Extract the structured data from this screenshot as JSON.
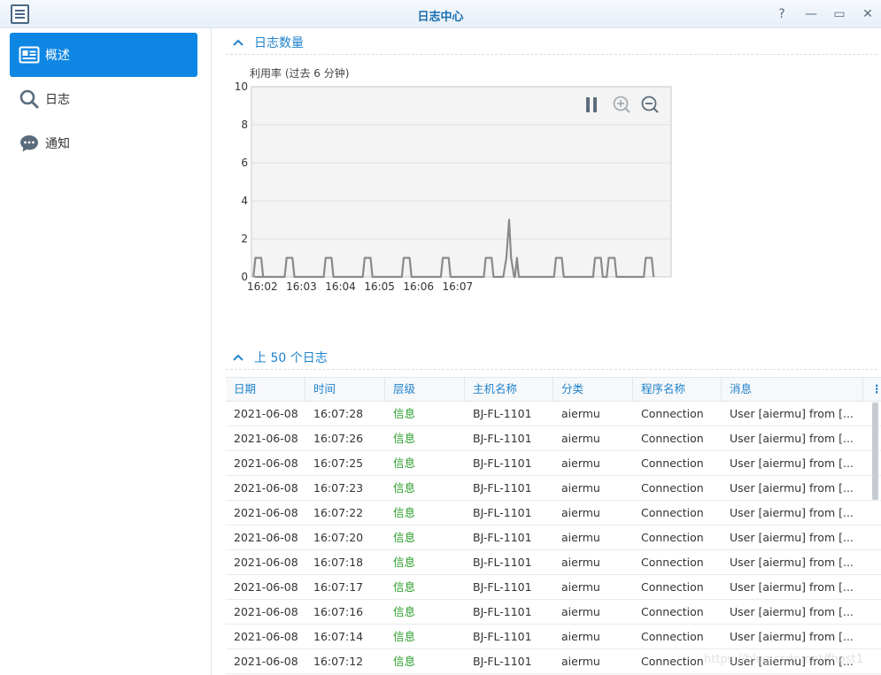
{
  "window": {
    "title": "日志中心",
    "help_label": "?",
    "minimize_label": "—",
    "maximize_label": "▭",
    "close_label": "✕"
  },
  "sidebar": {
    "items": [
      {
        "label": "概述",
        "icon": "overview-icon",
        "active": true
      },
      {
        "label": "日志",
        "icon": "search-icon",
        "active": false
      },
      {
        "label": "通知",
        "icon": "chat-bubble-icon",
        "active": false
      }
    ]
  },
  "log_count_section": {
    "title": "日志数量",
    "subtitle": "利用率 (过去 6 分钟)"
  },
  "chart_data": {
    "type": "area",
    "ylim": [
      0,
      10
    ],
    "yticks": [
      "0",
      "2",
      "4",
      "6",
      "8",
      "10"
    ],
    "xticks": [
      "16:02",
      "16:03",
      "16:04",
      "16:05",
      "16:06",
      "16:07"
    ],
    "grid": true,
    "series": [
      {
        "color": "#8a8a8a",
        "points": [
          [
            16.01,
            0
          ],
          [
            16.015,
            1
          ],
          [
            16.03,
            1
          ],
          [
            16.035,
            0
          ],
          [
            16.015,
            0
          ],
          [
            16.09,
            0
          ],
          [
            16.095,
            1
          ],
          [
            16.11,
            1
          ],
          [
            16.115,
            0
          ],
          [
            16.19,
            0
          ],
          [
            16.195,
            1
          ],
          [
            16.21,
            1
          ],
          [
            16.215,
            0
          ],
          [
            16.29,
            0
          ],
          [
            16.295,
            1
          ],
          [
            16.31,
            1
          ],
          [
            16.315,
            0
          ],
          [
            16.39,
            0
          ],
          [
            16.395,
            1
          ],
          [
            16.41,
            1
          ],
          [
            16.415,
            0
          ],
          [
            16.49,
            0
          ],
          [
            16.495,
            1
          ],
          [
            16.51,
            1
          ],
          [
            16.515,
            0
          ],
          [
            16.6,
            0
          ],
          [
            16.605,
            1
          ],
          [
            16.62,
            1
          ],
          [
            16.625,
            0
          ],
          [
            16.65,
            0
          ],
          [
            16.658,
            1
          ],
          [
            16.665,
            3
          ],
          [
            16.67,
            1
          ],
          [
            16.678,
            0
          ],
          [
            16.68,
            0
          ],
          [
            16.685,
            1
          ],
          [
            16.69,
            0
          ],
          [
            16.78,
            0
          ],
          [
            16.785,
            1
          ],
          [
            16.8,
            1
          ],
          [
            16.805,
            0
          ],
          [
            16.88,
            0
          ],
          [
            16.885,
            1
          ],
          [
            16.9,
            1
          ],
          [
            16.905,
            0
          ],
          [
            16.915,
            0
          ],
          [
            16.92,
            1
          ],
          [
            16.935,
            1
          ],
          [
            16.94,
            0
          ],
          [
            17.01,
            0
          ],
          [
            17.015,
            1
          ],
          [
            17.03,
            1
          ],
          [
            17.035,
            0
          ]
        ]
      }
    ],
    "controls": [
      "pause-icon",
      "zoom-in-icon",
      "zoom-out-icon"
    ]
  },
  "top_logs_section": {
    "title": "上 50 个日志"
  },
  "table": {
    "columns": [
      "日期",
      "时间",
      "层级",
      "主机名称",
      "分类",
      "程序名称",
      "消息",
      "⋮"
    ],
    "rows": [
      [
        "2021-06-08",
        "16:07:28",
        "信息",
        "BJ-FL-1101",
        "aiermu",
        "Connection",
        "User [aiermu] from [..."
      ],
      [
        "2021-06-08",
        "16:07:26",
        "信息",
        "BJ-FL-1101",
        "aiermu",
        "Connection",
        "User [aiermu] from [..."
      ],
      [
        "2021-06-08",
        "16:07:25",
        "信息",
        "BJ-FL-1101",
        "aiermu",
        "Connection",
        "User [aiermu] from [..."
      ],
      [
        "2021-06-08",
        "16:07:23",
        "信息",
        "BJ-FL-1101",
        "aiermu",
        "Connection",
        "User [aiermu] from [..."
      ],
      [
        "2021-06-08",
        "16:07:22",
        "信息",
        "BJ-FL-1101",
        "aiermu",
        "Connection",
        "User [aiermu] from [..."
      ],
      [
        "2021-06-08",
        "16:07:20",
        "信息",
        "BJ-FL-1101",
        "aiermu",
        "Connection",
        "User [aiermu] from [..."
      ],
      [
        "2021-06-08",
        "16:07:18",
        "信息",
        "BJ-FL-1101",
        "aiermu",
        "Connection",
        "User [aiermu] from [..."
      ],
      [
        "2021-06-08",
        "16:07:17",
        "信息",
        "BJ-FL-1101",
        "aiermu",
        "Connection",
        "User [aiermu] from [..."
      ],
      [
        "2021-06-08",
        "16:07:16",
        "信息",
        "BJ-FL-1101",
        "aiermu",
        "Connection",
        "User [aiermu] from [..."
      ],
      [
        "2021-06-08",
        "16:07:14",
        "信息",
        "BJ-FL-1101",
        "aiermu",
        "Connection",
        "User [aiermu] from [..."
      ],
      [
        "2021-06-08",
        "16:07:12",
        "信息",
        "BJ-FL-1101",
        "aiermu",
        "Connection",
        "User [aiermu] from [..."
      ]
    ]
  },
  "watermark": "https://blog.csdn.net/fhost1"
}
